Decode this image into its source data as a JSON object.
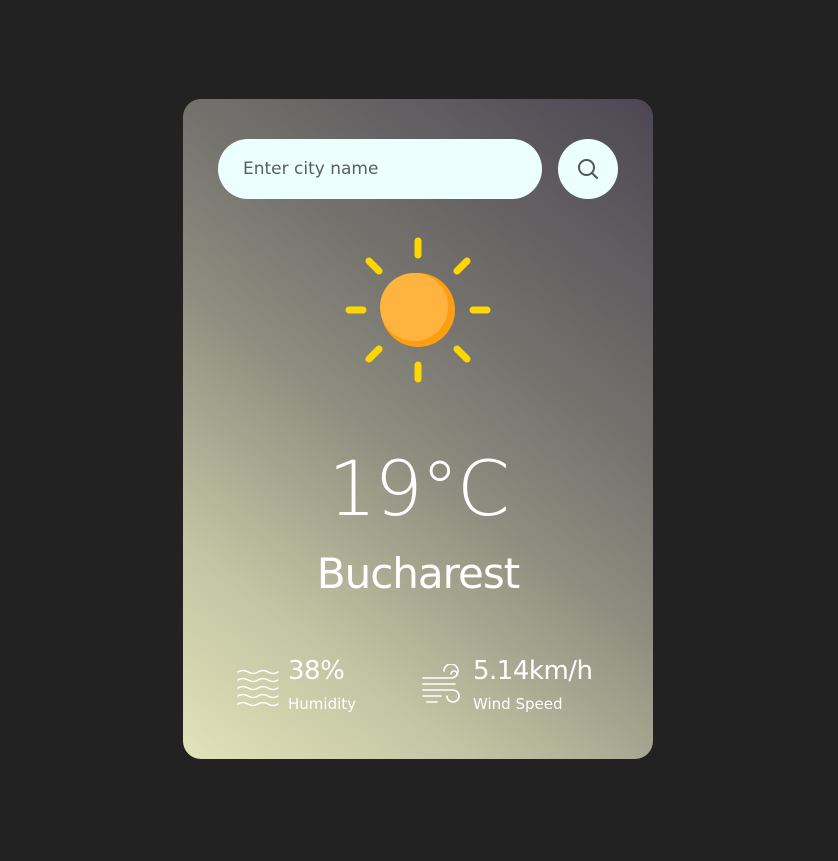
{
  "search": {
    "placeholder": "Enter city name",
    "value": "",
    "button_icon": "search-icon"
  },
  "weather": {
    "icon": "sun-icon",
    "temperature": "19°C",
    "city": "Bucharest"
  },
  "details": {
    "humidity": {
      "icon": "humidity-waves-icon",
      "value": "38%",
      "label": "Humidity"
    },
    "wind": {
      "icon": "wind-icon",
      "value": "5.14km/h",
      "label": "Wind Speed"
    }
  },
  "colors": {
    "page_background": "#222222",
    "input_background": "#ebfffc",
    "sun_core": "#ffb43f",
    "sun_rays": "#ffd600",
    "text": "#ffffff"
  }
}
